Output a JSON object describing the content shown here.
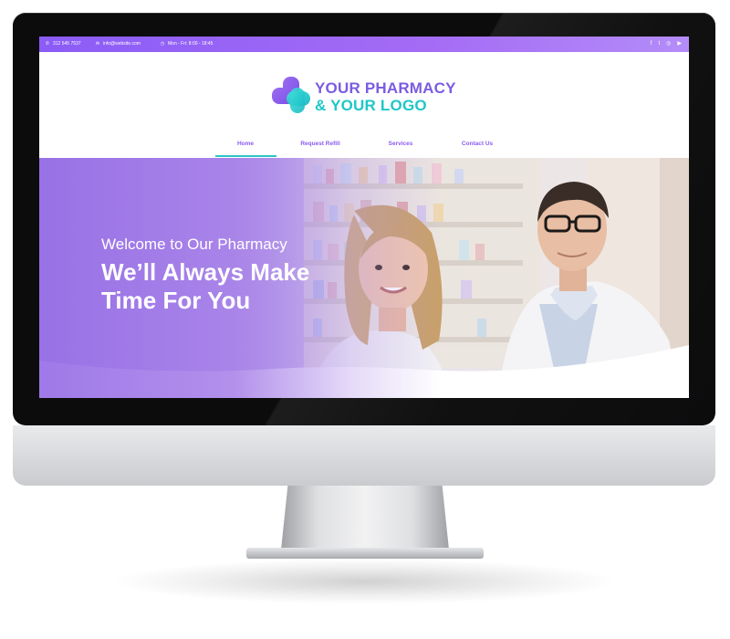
{
  "topbar": {
    "phone": "312 545 7537",
    "email": "info@website.com",
    "hours": "Mon - Fri: 8:00 - 18:45",
    "social_icons": [
      "facebook-icon",
      "twitter-icon",
      "instagram-icon",
      "youtube-icon"
    ]
  },
  "logo": {
    "line1": "YOUR PHARMACY",
    "line2": "& YOUR LOGO"
  },
  "nav": {
    "items": [
      {
        "label": "Home"
      },
      {
        "label": "Request Refill"
      },
      {
        "label": "Services"
      },
      {
        "label": "Contact Us"
      }
    ],
    "active": "Home"
  },
  "hero": {
    "subtitle": "Welcome to Our Pharmacy",
    "title_line1": "We’ll Always Make",
    "title_line2": "Time For You"
  },
  "colors": {
    "brand_purple": "#8b5cf6",
    "brand_teal": "#1ec7c8",
    "nav_text": "#8a5cf0"
  }
}
